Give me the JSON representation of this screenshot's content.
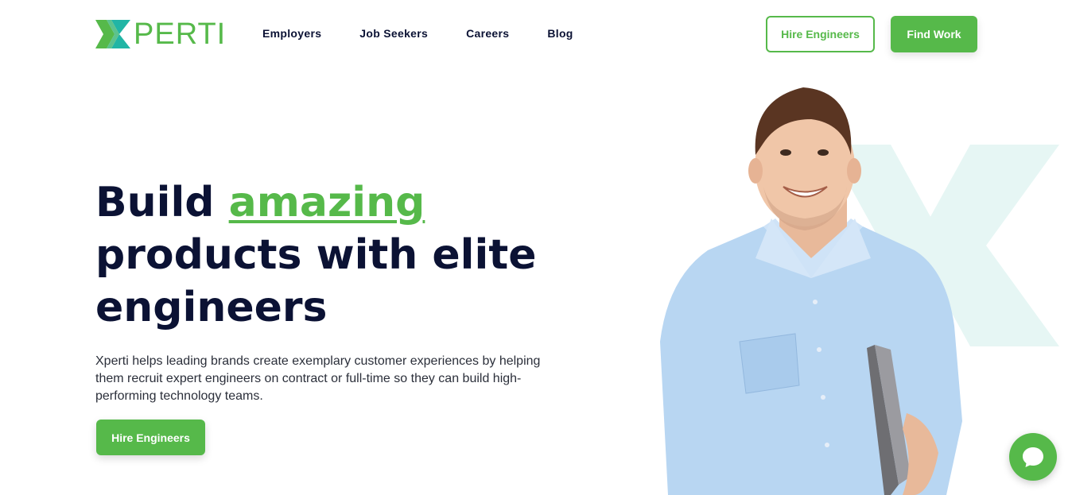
{
  "brand": {
    "logo_text": "PERTI",
    "accent_color": "#56b94a",
    "mark_color": "#21b5a5",
    "text_color": "#0b1234"
  },
  "nav": {
    "items": [
      {
        "label": "Employers"
      },
      {
        "label": "Job Seekers"
      },
      {
        "label": "Careers"
      },
      {
        "label": "Blog"
      }
    ]
  },
  "header_actions": {
    "hire_label": "Hire Engineers",
    "find_work_label": "Find Work"
  },
  "hero": {
    "headline_part1": "Build ",
    "headline_accent": "amazing",
    "headline_part2": "products with elite engineers",
    "description": "Xperti helps leading brands create exemplary customer experiences by helping them recruit expert engineers on contract or full-time so they can build high-performing technology teams.",
    "cta_label": "Hire Engineers",
    "image": "smiling-man-holding-laptop"
  },
  "chat": {
    "icon": "chat-bubble-icon"
  }
}
